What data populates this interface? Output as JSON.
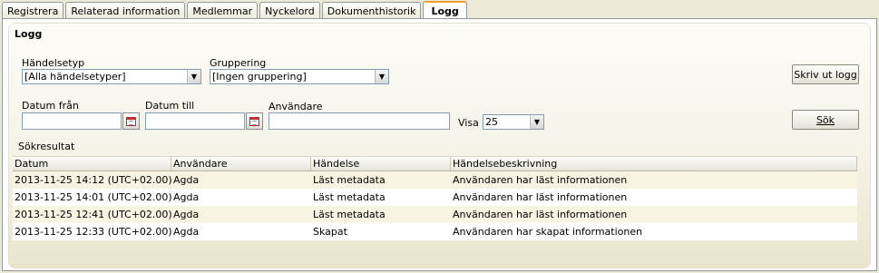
{
  "tabs": [
    {
      "label": "Registrera"
    },
    {
      "label": "Relaterad information"
    },
    {
      "label": "Medlemmar"
    },
    {
      "label": "Nyckelord"
    },
    {
      "label": "Dokumenthistorik"
    },
    {
      "label": "Logg",
      "active": true
    }
  ],
  "section_title": "Logg",
  "filters": {
    "event_type_label": "Händelsetyp",
    "event_type_value": "[Alla händelsetyper]",
    "grouping_label": "Gruppering",
    "grouping_value": "[Ingen gruppering]",
    "date_from_label": "Datum från",
    "date_from_value": "",
    "date_to_label": "Datum till",
    "date_to_value": "",
    "user_label": "Användare",
    "user_value": "",
    "show_label": "Visa",
    "show_value": "25"
  },
  "buttons": {
    "print_log": "Skriv ut logg",
    "search": "Sök"
  },
  "results": {
    "title": "Sökresultat",
    "columns": [
      "Datum",
      "Användare",
      "Händelse",
      "Händelsebeskrivning"
    ],
    "rows": [
      [
        "2013-11-25 14:12 (UTC+02.00)",
        "Agda",
        "Läst metadata",
        "Användaren har läst informationen"
      ],
      [
        "2013-11-25 14:01 (UTC+02.00)",
        "Agda",
        "Läst metadata",
        "Användaren har läst informationen"
      ],
      [
        "2013-11-25 12:41 (UTC+02.00)",
        "Agda",
        "Läst metadata",
        "Användaren har läst informationen"
      ],
      [
        "2013-11-25 12:33 (UTC+02.00)",
        "Agda",
        "Skapat",
        "Användaren har skapat informationen"
      ]
    ]
  }
}
